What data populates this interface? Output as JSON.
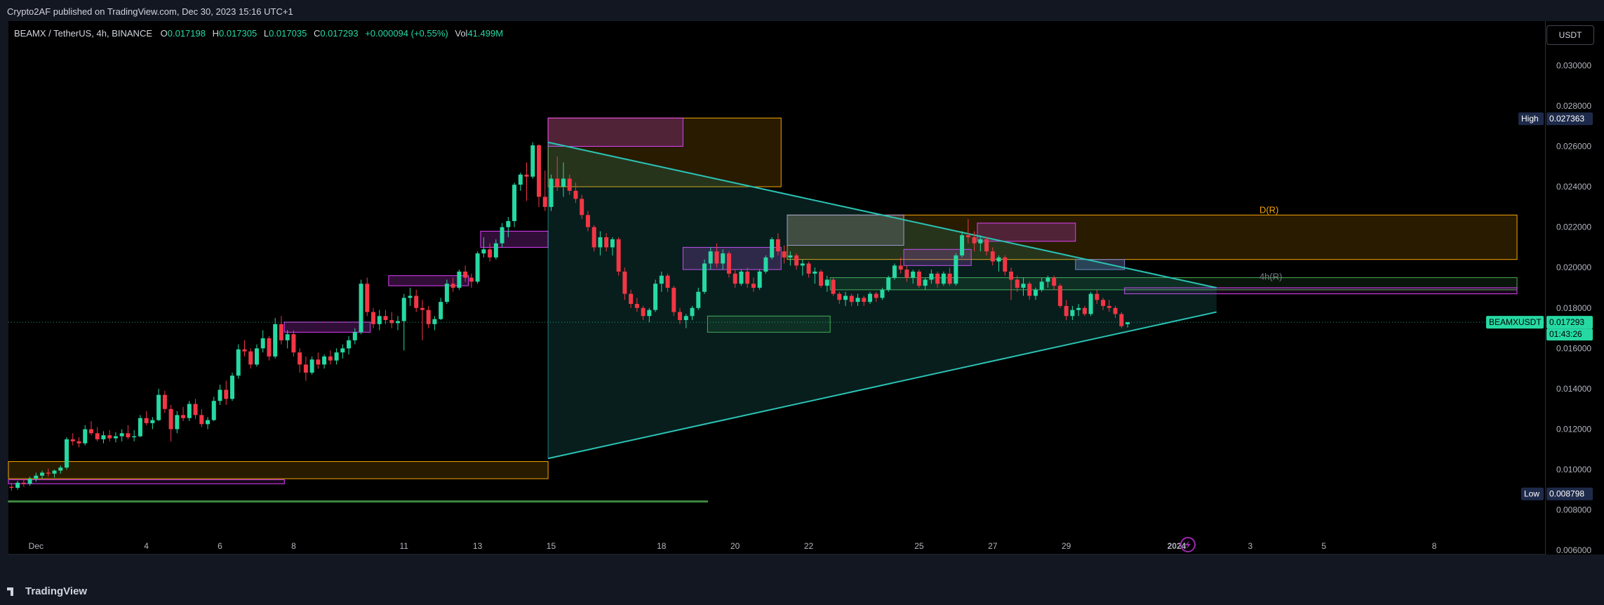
{
  "header": {
    "published": "Crypto2AF published on TradingView.com, Dec 30, 2023 15:16 UTC+1"
  },
  "legend": {
    "symbol": "BEAMX / TetherUS, 4h, BINANCE",
    "o_label": "O",
    "o": "0.017198",
    "h_label": "H",
    "h": "0.017305",
    "l_label": "L",
    "l": "0.017035",
    "c_label": "C",
    "c": "0.017293",
    "change": "+0.000094 (+0.55%)",
    "vol_label": "Vol",
    "vol": "41.499M"
  },
  "currency_button": "USDT",
  "footer": {
    "brand": "TradingView"
  },
  "colors": {
    "up": "#26d9a3",
    "down": "#f23645",
    "triangle": "#2ac3b4",
    "supply": "#f7a600",
    "pink": "#e040fb",
    "green_zone": "#4caf50",
    "badge_high": "#1e2a4a"
  },
  "chart_data": {
    "type": "candlestick",
    "title": "BEAMX / TetherUS, 4h, BINANCE",
    "ylim": [
      0.0058,
      0.0322
    ],
    "y_ticks": [
      "0.030000",
      "0.028000",
      "0.026000",
      "0.024000",
      "0.022000",
      "0.020000",
      "0.018000",
      "0.016000",
      "0.014000",
      "0.012000",
      "0.010000",
      "0.008000",
      "0.006000"
    ],
    "y_tick_values": [
      0.03,
      0.028,
      0.026,
      0.024,
      0.022,
      0.02,
      0.018,
      0.016,
      0.014,
      0.012,
      0.01,
      0.008,
      0.006
    ],
    "x_ticks": [
      {
        "label": "Dec",
        "t": 4.5
      },
      {
        "label": "4",
        "t": 22.5
      },
      {
        "label": "6",
        "t": 34.5
      },
      {
        "label": "8",
        "t": 46.5
      },
      {
        "label": "11",
        "t": 64.5
      },
      {
        "label": "13",
        "t": 76.5
      },
      {
        "label": "15",
        "t": 88.5
      },
      {
        "label": "18",
        "t": 106.5
      },
      {
        "label": "20",
        "t": 118.5
      },
      {
        "label": "22",
        "t": 130.5
      },
      {
        "label": "25",
        "t": 148.5
      },
      {
        "label": "27",
        "t": 160.5
      },
      {
        "label": "29",
        "t": 172.5
      },
      {
        "label": "2024",
        "t": 190.5
      },
      {
        "label": "3",
        "t": 202.5
      },
      {
        "label": "5",
        "t": 214.5
      },
      {
        "label": "8",
        "t": 232.5
      }
    ],
    "candles": [
      [
        0.00915,
        0.00935,
        0.00895,
        0.0091
      ],
      [
        0.0091,
        0.00945,
        0.009,
        0.00935
      ],
      [
        0.00935,
        0.0095,
        0.00915,
        0.0093
      ],
      [
        0.0093,
        0.00965,
        0.0092,
        0.00955
      ],
      [
        0.00955,
        0.00985,
        0.0094,
        0.0097
      ],
      [
        0.0097,
        0.00995,
        0.00955,
        0.00985
      ],
      [
        0.00985,
        0.01005,
        0.00965,
        0.0098
      ],
      [
        0.0098,
        0.01,
        0.0096,
        0.00995
      ],
      [
        0.00995,
        0.0102,
        0.0098,
        0.0101
      ],
      [
        0.0101,
        0.0116,
        0.01,
        0.0115
      ],
      [
        0.0115,
        0.0118,
        0.0112,
        0.0114
      ],
      [
        0.0114,
        0.0116,
        0.0111,
        0.0113
      ],
      [
        0.0113,
        0.0122,
        0.0112,
        0.012
      ],
      [
        0.012,
        0.0124,
        0.0117,
        0.0118
      ],
      [
        0.0118,
        0.0121,
        0.0114,
        0.0115
      ],
      [
        0.0115,
        0.0119,
        0.0113,
        0.0117
      ],
      [
        0.0117,
        0.01195,
        0.0114,
        0.01155
      ],
      [
        0.01155,
        0.01185,
        0.01135,
        0.01165
      ],
      [
        0.01165,
        0.012,
        0.0114,
        0.0118
      ],
      [
        0.0118,
        0.0122,
        0.0115,
        0.0116
      ],
      [
        0.0116,
        0.01195,
        0.0114,
        0.01165
      ],
      [
        0.01165,
        0.0127,
        0.0116,
        0.01255
      ],
      [
        0.01255,
        0.0129,
        0.0122,
        0.0123
      ],
      [
        0.0123,
        0.0126,
        0.012,
        0.01245
      ],
      [
        0.01245,
        0.014,
        0.0124,
        0.0137
      ],
      [
        0.0137,
        0.0139,
        0.0128,
        0.013
      ],
      [
        0.013,
        0.0132,
        0.0114,
        0.012
      ],
      [
        0.012,
        0.0129,
        0.0118,
        0.0127
      ],
      [
        0.0127,
        0.0131,
        0.0124,
        0.01255
      ],
      [
        0.01255,
        0.0134,
        0.0124,
        0.01325
      ],
      [
        0.01325,
        0.0135,
        0.0125,
        0.0127
      ],
      [
        0.0127,
        0.013,
        0.0121,
        0.01225
      ],
      [
        0.01225,
        0.0126,
        0.012,
        0.01245
      ],
      [
        0.01245,
        0.0136,
        0.0124,
        0.0134
      ],
      [
        0.0134,
        0.0142,
        0.0132,
        0.01395
      ],
      [
        0.01395,
        0.0144,
        0.0132,
        0.0135
      ],
      [
        0.0135,
        0.0148,
        0.0134,
        0.01465
      ],
      [
        0.01465,
        0.0162,
        0.0145,
        0.01595
      ],
      [
        0.01595,
        0.0164,
        0.0156,
        0.01585
      ],
      [
        0.01585,
        0.016,
        0.015,
        0.0152
      ],
      [
        0.0152,
        0.0162,
        0.0151,
        0.016
      ],
      [
        0.016,
        0.0169,
        0.0158,
        0.0165
      ],
      [
        0.0165,
        0.0166,
        0.0154,
        0.0156
      ],
      [
        0.0156,
        0.0175,
        0.0155,
        0.0172
      ],
      [
        0.0172,
        0.0176,
        0.0162,
        0.0164
      ],
      [
        0.0164,
        0.0169,
        0.016,
        0.0167
      ],
      [
        0.0167,
        0.0169,
        0.0156,
        0.0158
      ],
      [
        0.0158,
        0.016,
        0.0148,
        0.0152
      ],
      [
        0.0152,
        0.0156,
        0.0144,
        0.0148
      ],
      [
        0.0148,
        0.0156,
        0.0147,
        0.01545
      ],
      [
        0.01545,
        0.0158,
        0.015,
        0.0152
      ],
      [
        0.0152,
        0.0157,
        0.015,
        0.0156
      ],
      [
        0.0156,
        0.0159,
        0.0152,
        0.0154
      ],
      [
        0.0154,
        0.016,
        0.0152,
        0.0158
      ],
      [
        0.0158,
        0.0162,
        0.0155,
        0.016
      ],
      [
        0.016,
        0.0166,
        0.0157,
        0.0164
      ],
      [
        0.0164,
        0.017,
        0.0162,
        0.0168
      ],
      [
        0.0168,
        0.0194,
        0.0167,
        0.0192
      ],
      [
        0.0192,
        0.0195,
        0.0176,
        0.0178
      ],
      [
        0.0178,
        0.018,
        0.017,
        0.0172
      ],
      [
        0.0172,
        0.0179,
        0.0169,
        0.0176
      ],
      [
        0.0176,
        0.0179,
        0.0172,
        0.0174
      ],
      [
        0.0174,
        0.0178,
        0.017,
        0.01725
      ],
      [
        0.01725,
        0.0176,
        0.0169,
        0.01735
      ],
      [
        0.01735,
        0.0187,
        0.0159,
        0.0185
      ],
      [
        0.0185,
        0.019,
        0.0181,
        0.0186
      ],
      [
        0.0186,
        0.0189,
        0.0178,
        0.018
      ],
      [
        0.018,
        0.0184,
        0.0164,
        0.0179
      ],
      [
        0.0179,
        0.0181,
        0.017,
        0.0172
      ],
      [
        0.0172,
        0.0176,
        0.0169,
        0.01745
      ],
      [
        0.01745,
        0.0185,
        0.0174,
        0.0183
      ],
      [
        0.0183,
        0.0194,
        0.0182,
        0.0192
      ],
      [
        0.0192,
        0.0195,
        0.0188,
        0.019
      ],
      [
        0.019,
        0.0199,
        0.0189,
        0.0198
      ],
      [
        0.0198,
        0.0201,
        0.0193,
        0.0195
      ],
      [
        0.0195,
        0.0197,
        0.019,
        0.0193
      ],
      [
        0.0193,
        0.0208,
        0.0192,
        0.0207
      ],
      [
        0.0207,
        0.0215,
        0.0205,
        0.0209
      ],
      [
        0.0209,
        0.0212,
        0.0203,
        0.0205
      ],
      [
        0.0205,
        0.0214,
        0.0204,
        0.0212
      ],
      [
        0.0212,
        0.0222,
        0.021,
        0.022
      ],
      [
        0.022,
        0.0225,
        0.0215,
        0.0223
      ],
      [
        0.0223,
        0.0242,
        0.022,
        0.0241
      ],
      [
        0.0241,
        0.0247,
        0.0238,
        0.0246
      ],
      [
        0.0246,
        0.0252,
        0.0233,
        0.0245
      ],
      [
        0.0245,
        0.0262,
        0.0244,
        0.02605
      ],
      [
        0.02605,
        0.0261,
        0.023,
        0.0235
      ],
      [
        0.0235,
        0.0248,
        0.0228,
        0.023
      ],
      [
        0.023,
        0.0246,
        0.0228,
        0.0244
      ],
      [
        0.0244,
        0.0255,
        0.0238,
        0.024
      ],
      [
        0.024,
        0.0252,
        0.0235,
        0.0244
      ],
      [
        0.0244,
        0.0246,
        0.0236,
        0.0238
      ],
      [
        0.0238,
        0.0242,
        0.0232,
        0.0234
      ],
      [
        0.0234,
        0.0236,
        0.0224,
        0.0226
      ],
      [
        0.0226,
        0.0228,
        0.0218,
        0.022
      ],
      [
        0.022,
        0.0221,
        0.0208,
        0.021
      ],
      [
        0.021,
        0.0218,
        0.0206,
        0.0215
      ],
      [
        0.0215,
        0.0217,
        0.0208,
        0.021
      ],
      [
        0.021,
        0.0215,
        0.0206,
        0.0214
      ],
      [
        0.0214,
        0.0215,
        0.0196,
        0.0198
      ],
      [
        0.0198,
        0.02,
        0.0184,
        0.0187
      ],
      [
        0.0187,
        0.0189,
        0.018,
        0.0182
      ],
      [
        0.0182,
        0.0185,
        0.0178,
        0.018
      ],
      [
        0.018,
        0.0181,
        0.0174,
        0.0176
      ],
      [
        0.0176,
        0.018,
        0.0173,
        0.0179
      ],
      [
        0.0179,
        0.0194,
        0.0178,
        0.0192
      ],
      [
        0.0192,
        0.0198,
        0.0188,
        0.0196
      ],
      [
        0.0196,
        0.0197,
        0.0188,
        0.019
      ],
      [
        0.019,
        0.0191,
        0.0176,
        0.0178
      ],
      [
        0.0178,
        0.018,
        0.0172,
        0.0174
      ],
      [
        0.0174,
        0.0177,
        0.017,
        0.0176
      ],
      [
        0.0176,
        0.0181,
        0.0174,
        0.018
      ],
      [
        0.018,
        0.019,
        0.0179,
        0.0188
      ],
      [
        0.0188,
        0.0204,
        0.0187,
        0.0202
      ],
      [
        0.0202,
        0.021,
        0.0199,
        0.0208
      ],
      [
        0.0208,
        0.0212,
        0.02,
        0.0202
      ],
      [
        0.0202,
        0.0209,
        0.0199,
        0.0207
      ],
      [
        0.0207,
        0.0208,
        0.0195,
        0.0197
      ],
      [
        0.0197,
        0.0199,
        0.019,
        0.0192
      ],
      [
        0.0192,
        0.0199,
        0.0191,
        0.0198
      ],
      [
        0.0198,
        0.02,
        0.019,
        0.0192
      ],
      [
        0.0192,
        0.0195,
        0.0188,
        0.019
      ],
      [
        0.019,
        0.0199,
        0.0189,
        0.0198
      ],
      [
        0.0198,
        0.0206,
        0.0197,
        0.0205
      ],
      [
        0.0205,
        0.0215,
        0.0204,
        0.0214
      ],
      [
        0.0214,
        0.0217,
        0.0206,
        0.0208
      ],
      [
        0.0208,
        0.0211,
        0.0202,
        0.0205
      ],
      [
        0.0205,
        0.0208,
        0.0201,
        0.0206
      ],
      [
        0.0206,
        0.0207,
        0.0199,
        0.0201
      ],
      [
        0.0201,
        0.0204,
        0.0196,
        0.0202
      ],
      [
        0.0202,
        0.0203,
        0.0195,
        0.0197
      ],
      [
        0.0197,
        0.02,
        0.0192,
        0.0198
      ],
      [
        0.0198,
        0.0199,
        0.019,
        0.0191
      ],
      [
        0.0191,
        0.0196,
        0.0188,
        0.0194
      ],
      [
        0.0194,
        0.0195,
        0.0186,
        0.0187
      ],
      [
        0.0187,
        0.0188,
        0.0182,
        0.0184
      ],
      [
        0.0184,
        0.0188,
        0.0181,
        0.0186
      ],
      [
        0.0186,
        0.0187,
        0.0181,
        0.0183
      ],
      [
        0.0183,
        0.0187,
        0.0181,
        0.0185
      ],
      [
        0.0185,
        0.0186,
        0.0181,
        0.0183
      ],
      [
        0.0183,
        0.0188,
        0.0182,
        0.0187
      ],
      [
        0.0187,
        0.0188,
        0.0183,
        0.0185
      ],
      [
        0.0185,
        0.019,
        0.0184,
        0.0189
      ],
      [
        0.0189,
        0.0196,
        0.0188,
        0.0195
      ],
      [
        0.0195,
        0.0202,
        0.0194,
        0.0201
      ],
      [
        0.0201,
        0.0205,
        0.0197,
        0.0199
      ],
      [
        0.0199,
        0.0201,
        0.0193,
        0.0195
      ],
      [
        0.0195,
        0.0199,
        0.0192,
        0.0198
      ],
      [
        0.0198,
        0.0199,
        0.019,
        0.0191
      ],
      [
        0.0191,
        0.0195,
        0.0189,
        0.0194
      ],
      [
        0.0194,
        0.0199,
        0.0192,
        0.0197
      ],
      [
        0.0197,
        0.0198,
        0.019,
        0.0192
      ],
      [
        0.0192,
        0.0198,
        0.0191,
        0.0197
      ],
      [
        0.0197,
        0.02,
        0.0191,
        0.0192
      ],
      [
        0.0192,
        0.0207,
        0.0191,
        0.0206
      ],
      [
        0.0206,
        0.0218,
        0.0205,
        0.0216
      ],
      [
        0.0216,
        0.0224,
        0.0212,
        0.0215
      ],
      [
        0.0215,
        0.0218,
        0.0208,
        0.0212
      ],
      [
        0.0212,
        0.0216,
        0.0208,
        0.0214
      ],
      [
        0.0214,
        0.0215,
        0.0206,
        0.0208
      ],
      [
        0.0208,
        0.021,
        0.0201,
        0.0203
      ],
      [
        0.0203,
        0.0206,
        0.0198,
        0.0205
      ],
      [
        0.0205,
        0.0206,
        0.0196,
        0.0198
      ],
      [
        0.0198,
        0.02,
        0.0184,
        0.0194
      ],
      [
        0.0194,
        0.0196,
        0.0188,
        0.019
      ],
      [
        0.019,
        0.0195,
        0.0186,
        0.0192
      ],
      [
        0.0192,
        0.0193,
        0.0184,
        0.0186
      ],
      [
        0.0186,
        0.019,
        0.0184,
        0.0189
      ],
      [
        0.0189,
        0.0195,
        0.0188,
        0.0193
      ],
      [
        0.0193,
        0.0196,
        0.019,
        0.0195
      ],
      [
        0.0195,
        0.0196,
        0.0189,
        0.0191
      ],
      [
        0.0191,
        0.0192,
        0.018,
        0.0181
      ],
      [
        0.0181,
        0.0184,
        0.0174,
        0.0176
      ],
      [
        0.0176,
        0.0181,
        0.0174,
        0.0179
      ],
      [
        0.0179,
        0.0182,
        0.0176,
        0.018
      ],
      [
        0.018,
        0.0181,
        0.0176,
        0.0177
      ],
      [
        0.0177,
        0.0188,
        0.0176,
        0.0187
      ],
      [
        0.0187,
        0.0189,
        0.0182,
        0.0184
      ],
      [
        0.0184,
        0.0185,
        0.0179,
        0.0181
      ],
      [
        0.0181,
        0.0184,
        0.0178,
        0.018
      ],
      [
        0.018,
        0.0181,
        0.0175,
        0.0177
      ],
      [
        0.0177,
        0.0178,
        0.017,
        0.0171
      ],
      [
        0.017198,
        0.017305,
        0.017035,
        0.017293
      ]
    ],
    "triangle": {
      "upper": [
        [
          88,
          0.0262
        ],
        [
          197,
          0.019
        ]
      ],
      "lower": [
        [
          88,
          0.01055
        ],
        [
          197,
          0.0178
        ]
      ]
    },
    "zones": [
      {
        "kind": "supply",
        "t0": 88,
        "t1": 126,
        "y0": 0.024,
        "y1": 0.0274
      },
      {
        "kind": "pink",
        "t0": 88,
        "t1": 110,
        "y0": 0.026,
        "y1": 0.0274
      },
      {
        "kind": "supply",
        "t0": 127,
        "t1": 246,
        "y0": 0.0204,
        "y1": 0.0226
      },
      {
        "kind": "gray",
        "t0": 127,
        "t1": 146,
        "y0": 0.0211,
        "y1": 0.0226
      },
      {
        "kind": "pink",
        "t0": 158,
        "t1": 174,
        "y0": 0.0213,
        "y1": 0.0222
      },
      {
        "kind": "pink",
        "t0": 110,
        "t1": 126,
        "y0": 0.0199,
        "y1": 0.021
      },
      {
        "kind": "green",
        "t0": 114,
        "t1": 134,
        "y0": 0.0168,
        "y1": 0.0176
      },
      {
        "kind": "pink",
        "t0": 146,
        "t1": 157,
        "y0": 0.0201,
        "y1": 0.0209
      },
      {
        "kind": "green",
        "t0": 134,
        "t1": 246,
        "y0": 0.0189,
        "y1": 0.0195
      },
      {
        "kind": "blue",
        "t0": 174,
        "t1": 182,
        "y0": 0.0199,
        "y1": 0.0204
      },
      {
        "kind": "pinkline",
        "t0": 182,
        "t1": 246,
        "y0": 0.0187,
        "y1": 0.019
      },
      {
        "kind": "pink",
        "t0": 45,
        "t1": 59,
        "y0": 0.0168,
        "y1": 0.0173
      },
      {
        "kind": "pink",
        "t0": 62,
        "t1": 75,
        "y0": 0.0191,
        "y1": 0.0196
      },
      {
        "kind": "pink",
        "t0": 77,
        "t1": 88,
        "y0": 0.021,
        "y1": 0.0218
      },
      {
        "kind": "supply",
        "t0": 0,
        "t1": 88,
        "y0": 0.00955,
        "y1": 0.0104
      },
      {
        "kind": "pinkline",
        "t0": 0,
        "t1": 45,
        "y0": 0.0093,
        "y1": 0.0095
      },
      {
        "kind": "greenline",
        "t0": 0,
        "t1": 114,
        "y0": 0.0084,
        "y1": 0.00845
      }
    ],
    "annotations": [
      {
        "text": "D(R)",
        "t": 204,
        "y": 0.0227,
        "color": "#f7a600"
      },
      {
        "text": "4h(R)",
        "t": 204,
        "y": 0.0194,
        "color": "#787b86"
      }
    ],
    "labels": {
      "high_label": "High",
      "high_value": "0.027363",
      "high_y": 0.027363,
      "low_label": "Low",
      "low_value": "0.008798",
      "low_y": 0.008798,
      "symbol_badge": "BEAMXUSDT",
      "price": "0.017293",
      "price_y": 0.017293,
      "countdown": "01:43:26"
    }
  }
}
